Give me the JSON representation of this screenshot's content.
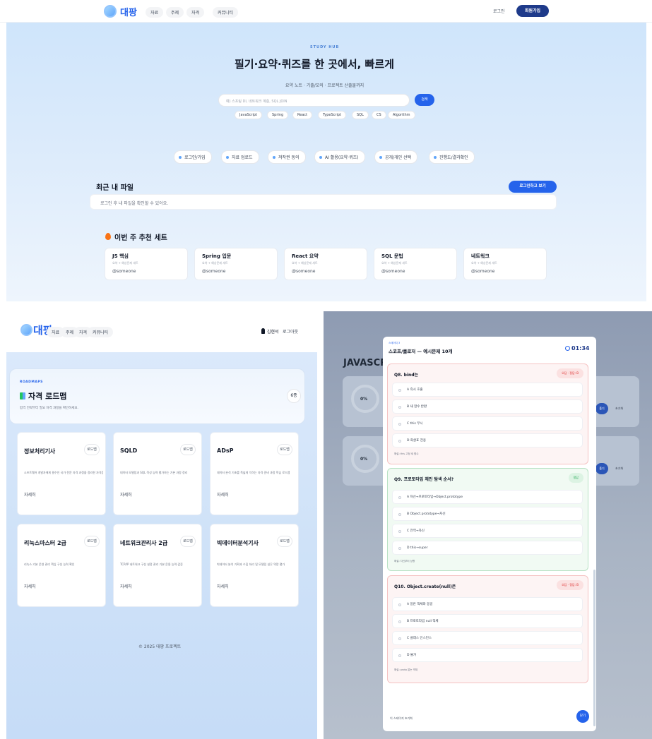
{
  "home": {
    "logo": "대팡",
    "nav": [
      "자료",
      "주제",
      "자격",
      "커뮤니티"
    ],
    "login_label": "로그인",
    "signup_label": "회원가입",
    "eyebrow": "STUDY HUB",
    "title": "필기·요약·퀴즈를 한 곳에서, 빠르게",
    "subtitle": "요약 노트 · 기출/모의 · 프로젝트 산출물까지",
    "search_placeholder": "예) 스프링 DI, 네트워크 계층, SQL JOIN",
    "search_button": "검색",
    "tags": [
      "JavaScript",
      "Spring",
      "React",
      "TypeScript",
      "SQL",
      "CS",
      "Algorithm"
    ],
    "features": [
      "로그인/가입",
      "자료 업로드",
      "저작권 동의",
      "AI 활용(요약·퀴즈)",
      "공개/개인 선택",
      "진행도/결과확인"
    ],
    "recent": {
      "title": "최근 내 파일",
      "button": "로그인하고 보기",
      "message": "로그인 후 내 파일을 확인할 수 있어요."
    },
    "recommend": {
      "title": "이번 주 추천 세트",
      "icon": "fire-icon",
      "cards": [
        {
          "title": "JS 핵심",
          "sub": "요약 + 예상문제 세트",
          "author": "@someone"
        },
        {
          "title": "Spring 입문",
          "sub": "요약 + 예상문제 세트",
          "author": "@someone"
        },
        {
          "title": "React 요약",
          "sub": "요약 + 예상문제 세트",
          "author": "@someone"
        },
        {
          "title": "SQL 문법",
          "sub": "요약 + 예상문제 세트",
          "author": "@someone"
        },
        {
          "title": "네트워크",
          "sub": "요약 + 예상문제 세트",
          "author": "@someone"
        }
      ]
    }
  },
  "roadmaps": {
    "logo": "대팡",
    "nav": [
      "자료",
      "주제",
      "자격",
      "커뮤니티"
    ],
    "user": "김현석",
    "logout": "로그아웃",
    "eyebrow": "ROADMAPS",
    "title": "자격 로드맵",
    "subtitle": "합격 전략부터 필요 자격 과정을 확인하세요.",
    "count": "6종",
    "badge": "로드맵",
    "more": "자세히",
    "footer": "© 2025 대팡 프로젝트",
    "cards": [
      {
        "title": "정보처리기사",
        "desc": "소프트웨어 개발자에게 필수인 국가 전문 자격 과정을 정리한 자격증 준비 가이드"
      },
      {
        "title": "SQLD",
        "desc": "데이터 모델링과 SQL 작성 능력 평가하는 기본 과정 정리"
      },
      {
        "title": "ADsP",
        "desc": "데이터 분석 기초를 폭넓게 익히는 자격 준비 과정 학습 로드맵"
      },
      {
        "title": "리눅스마스터 2급",
        "desc": "리눅스 기본 운영 관리 핵심 구성 능력 확인"
      },
      {
        "title": "네트워크관리사 2급",
        "desc": "TCP/IP 네트워크 구성 설정 관리 기본 운용 능력 검증"
      },
      {
        "title": "빅데이터분석기사",
        "desc": "빅데이터 분석 기획과 수집 처리 및 모델링 실무 역량 평가"
      }
    ]
  },
  "quiz": {
    "bg_heading": "JAVASCR",
    "bg_cards": [
      {
        "percent": "0%",
        "buttons": [
          "풀기",
          "초기화"
        ]
      },
      {
        "percent": "0%",
        "buttons": [
          "풀기",
          "초기화"
        ]
      }
    ],
    "modal": {
      "crumb": "스테이지 3",
      "title": "스코프/클로저 — 예시문제 10개",
      "timer": "01:34",
      "footer_left": "이 스테이지 초기화",
      "submit": "닫기"
    },
    "questions": [
      {
        "title": "Q8. bind는",
        "result": "오답 · 정답: B",
        "state": "wrong",
        "options": [
          "A  즉시 호출",
          "B  새 함수 반환",
          "C  this 무시",
          "D  화살표 전용"
        ],
        "note": "해설: this 고정 새 함수"
      },
      {
        "title": "Q9. 프로토타입 체인 탐색 순서?",
        "result": "정답",
        "state": "correct",
        "options": [
          "A  자신→프로토타입→Object.prototype",
          "B  Object.prototype→자신",
          "C  전역→자신",
          "D  this→super"
        ],
        "note": "해설: 자신부터 상향"
      },
      {
        "title": "Q10. Object.create(null)은",
        "result": "오답 · 정답: B",
        "state": "wrong",
        "options": [
          "A  일반 객체와 동일",
          "B  프로토타입 null 객체",
          "C  클래스 인스턴스",
          "D  불가"
        ],
        "note": "해설: proto 없는 객체"
      }
    ]
  }
}
